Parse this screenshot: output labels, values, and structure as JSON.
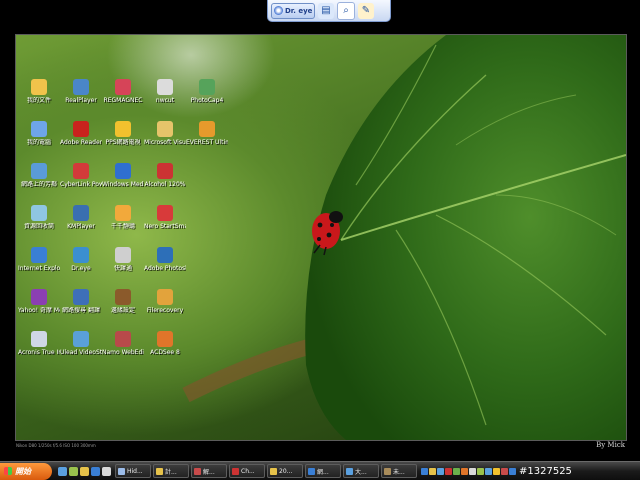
{
  "toolbar": {
    "logo_label": "Dr. eye",
    "buttons": [
      {
        "icon": "document-icon"
      },
      {
        "icon": "search-icon"
      },
      {
        "icon": "edit-icon"
      }
    ]
  },
  "desktop": {
    "icons": [
      {
        "label": "我的文件",
        "color": "#f1c34b"
      },
      {
        "label": "我的電腦",
        "color": "#6ea5e8"
      },
      {
        "label": "網路上的芳鄰",
        "color": "#5a9bd8"
      },
      {
        "label": "資源回收筒",
        "color": "#8fc6e2"
      },
      {
        "label": "Internet Explorer",
        "color": "#3a7fd5"
      },
      {
        "label": "Yahoo! 奇摩 Messenger",
        "color": "#8b3fb3"
      },
      {
        "label": "Acronis True Image Ho...",
        "color": "#cfd7e6"
      },
      {
        "label": "RealPlayer",
        "color": "#4a86c8"
      },
      {
        "label": "Adobe Reader 8",
        "color": "#c9231d"
      },
      {
        "label": "CyberLink PowerDVD",
        "color": "#d33a3a"
      },
      {
        "label": "KMPlayer",
        "color": "#3a6fb0"
      },
      {
        "label": "Dr.eye",
        "color": "#3b8fd0"
      },
      {
        "label": "網路搜尋 翻譯",
        "color": "#3e6fb8"
      },
      {
        "label": "Ulead VideoStudio 11",
        "color": "#5aa0d8"
      },
      {
        "label": "REGMAGNEC",
        "color": "#d64458"
      },
      {
        "label": "PPS網路電視",
        "color": "#f2c12e"
      },
      {
        "label": "Windows Media Player",
        "color": "#2f6fd0"
      },
      {
        "label": "千千靜聽",
        "color": "#f2a93b"
      },
      {
        "label": "快譯通",
        "color": "#cfcfcf"
      },
      {
        "label": "邊緣設定",
        "color": "#8b5a2b"
      },
      {
        "label": "Namo WebEditor 6",
        "color": "#b84a4a"
      },
      {
        "label": "nwcut",
        "color": "#dcdcdc"
      },
      {
        "label": "Microsoft Visual C++...",
        "color": "#e6c46a"
      },
      {
        "label": "Alcohol 120%",
        "color": "#c33"
      },
      {
        "label": "Nero StartSmart",
        "color": "#d83a3a"
      },
      {
        "label": "Adobe Photosh...",
        "color": "#2d6fb8"
      },
      {
        "label": "Filerecovery",
        "color": "#e2a33c"
      },
      {
        "label": "ACDSee 8",
        "color": "#e0752a"
      },
      {
        "label": "PhotoCap4",
        "color": "#56a35b"
      },
      {
        "label": "EVEREST Ultima...",
        "color": "#e69a2c"
      }
    ]
  },
  "wallpaper": {
    "status_line": "Nikon D80 1/250s f/5.6 ISO 100 300mm",
    "byline": "By Mick"
  },
  "taskbar": {
    "start_label": "開始",
    "quick_launch": [
      "#5aa0e0",
      "#9ac24d",
      "#e6c24a",
      "#3a7fd5",
      "#d9d9d9"
    ],
    "tasks": [
      {
        "label": "Hid...",
        "color": "#9bbbe8"
      },
      {
        "label": "計...",
        "color": "#e6c24a"
      },
      {
        "label": "解...",
        "color": "#c84b4b"
      },
      {
        "label": "Ch...",
        "color": "#c33"
      },
      {
        "label": "20...",
        "color": "#e6c24a"
      },
      {
        "label": "網...",
        "color": "#3a7fd5"
      },
      {
        "label": "大...",
        "color": "#5aa0e0"
      },
      {
        "label": "未...",
        "color": "#a88b5a"
      }
    ],
    "tray_colors": [
      "#3a7fd5",
      "#e6c24a",
      "#5aa0e0",
      "#c33",
      "#6ab04c",
      "#e0752a",
      "#d9d9d9",
      "#9ac24d",
      "#5aa0e0",
      "#f2c12e",
      "#c84b4b",
      "#3a7fd5"
    ],
    "clock": "#1327525"
  }
}
